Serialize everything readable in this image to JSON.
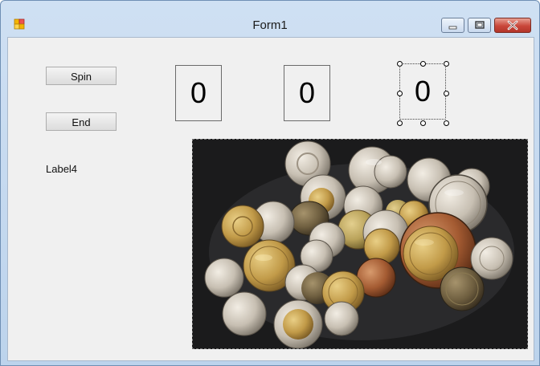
{
  "window": {
    "title": "Form1"
  },
  "buttons": {
    "spin_label": "Spin",
    "end_label": "End"
  },
  "label4": "Label4",
  "digits": [
    "0",
    "0",
    "0"
  ],
  "picture": {
    "subject": "coins-photo"
  },
  "colors": {
    "titlebar": "#c6dbf1",
    "client": "#f0f0f0",
    "close_button": "#c9473a"
  }
}
